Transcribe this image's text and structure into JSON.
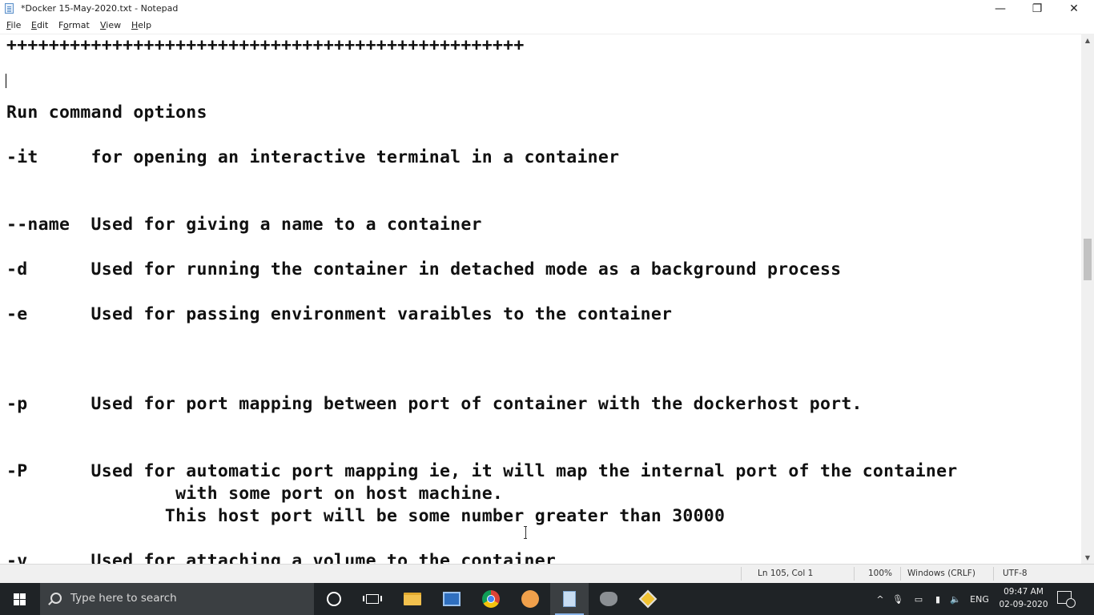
{
  "window": {
    "title": "*Docker 15-May-2020.txt - Notepad",
    "controls": {
      "minimize": "—",
      "maximize": "❐",
      "close": "✕"
    }
  },
  "menu": {
    "items": [
      {
        "first": "F",
        "rest": "ile"
      },
      {
        "first": "E",
        "rest": "dit"
      },
      {
        "first": "F",
        "rest": "ormat",
        "prefix": "F",
        "underline": "o",
        "tail": "rmat"
      },
      {
        "first": "V",
        "rest": "iew"
      },
      {
        "first": "H",
        "rest": "elp"
      }
    ]
  },
  "document": {
    "lines": [
      "+++++++++++++++++++++++++++++++++++++++++++++++++",
      "",
      "",
      "Run command options",
      "",
      "-it     for opening an interactive terminal in a container",
      "",
      "",
      "--name  Used for giving a name to a container",
      "",
      "-d      Used for running the container in detached mode as a background process",
      "",
      "-e      Used for passing environment varaibles to the container",
      "",
      "",
      "",
      "-p      Used for port mapping between port of container with the dockerhost port.",
      "",
      "",
      "-P      Used for automatic port mapping ie, it will map the internal port of the container",
      "                with some port on host machine.",
      "               This host port will be some number greater than 30000",
      "",
      "-v      Used for attaching a volume to the container"
    ]
  },
  "statusbar": {
    "position": "Ln 105, Col 1",
    "zoom": "100%",
    "line_ending": "Windows (CRLF)",
    "encoding": "UTF-8"
  },
  "taskbar": {
    "search_placeholder": "Type here to search",
    "language": "ENG",
    "time": "09:47 AM",
    "date": "02-09-2020"
  }
}
